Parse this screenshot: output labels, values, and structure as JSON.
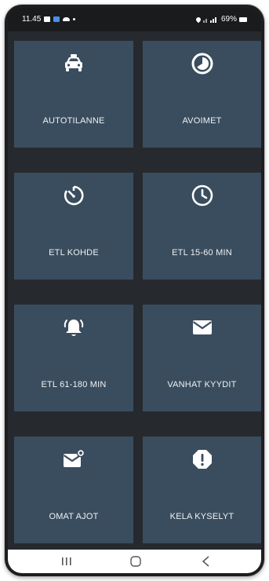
{
  "status_bar": {
    "time": "11.45",
    "battery": "69%"
  },
  "tiles": [
    {
      "label": "AUTOTILANNE",
      "icon": "taxi-car-icon"
    },
    {
      "label": "AVOIMET",
      "icon": "pie-clock-icon"
    },
    {
      "label": "ETL KOHDE",
      "icon": "timer-icon"
    },
    {
      "label": "ETL 15-60 MIN",
      "icon": "clock-icon"
    },
    {
      "label": "ETL 61-180 MIN",
      "icon": "alarm-bell-icon"
    },
    {
      "label": "VANHAT KYYDIT",
      "icon": "envelope-icon"
    },
    {
      "label": "OMAT AJOT",
      "icon": "envelope-badge-icon"
    },
    {
      "label": "KELA KYSELYT",
      "icon": "exclamation-icon"
    }
  ],
  "colors": {
    "tile": "#3a4d5e",
    "background": "#262a2f",
    "statusbar": "#1a1b1d"
  },
  "nav": {
    "recent": "recent-apps-icon",
    "home": "home-icon",
    "back": "back-icon"
  }
}
